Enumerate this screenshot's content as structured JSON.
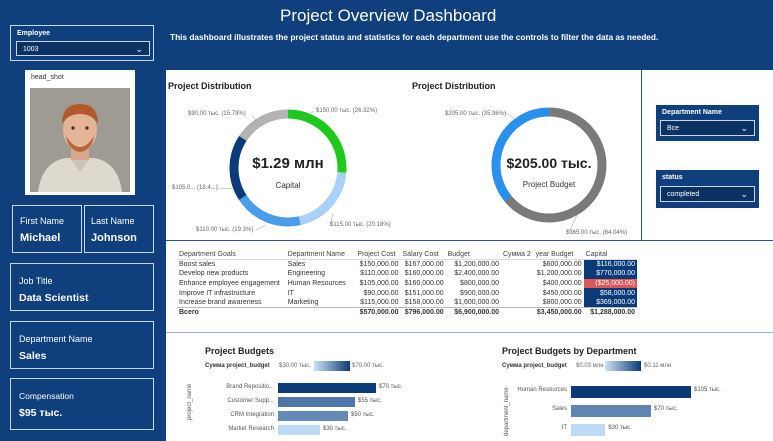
{
  "header": {
    "title": "Project Overview Dashboard",
    "subtitle": "This dashboard illustrates the project status and statistics for each department use the controls to filter the data as needed."
  },
  "employee_filter": {
    "label": "Employee",
    "value": "1003"
  },
  "photo": {
    "caption": "head_shot"
  },
  "profile": {
    "first_name_label": "First Name",
    "first_name": "Michael",
    "last_name_label": "Last Name",
    "last_name": "Johnson",
    "job_title_label": "Job Title",
    "job_title": "Data Scientist",
    "department_label": "Department Name",
    "department": "Sales",
    "compensation_label": "Compensation",
    "compensation": "$95 тыс."
  },
  "filters": {
    "department": {
      "label": "Department Name",
      "value": "Все"
    },
    "status": {
      "label": "status",
      "value": "completed"
    }
  },
  "donut1": {
    "title": "Project Distribution",
    "center_value": "$1.29 млн",
    "center_label": "Capital",
    "labels": {
      "top_right": "$150.00 тыс. (26.32%)",
      "right": "$115.00 тыс. (20.18%)",
      "bottom_left": "$110.00 тыс. (19.3%)",
      "left": "$105.0... (18.4...)",
      "top_left": "$90.00 тыс. (15.79%)"
    }
  },
  "donut2": {
    "title": "Project Distribution",
    "center_value": "$205.00 тыс.",
    "center_label": "Project Budget",
    "labels": {
      "top_left": "$205.00 тыс. (35.96%)",
      "bottom_right": "$365.00 тыс. (64.04%)"
    }
  },
  "table": {
    "headers": [
      "Department Goals",
      "Department Name",
      "Project Cost",
      "Salary Cost",
      "Budget",
      "Сумма 2",
      "year Budget",
      "Capital"
    ],
    "rows": [
      [
        "Boost sales",
        "Sales",
        "$150,000.00",
        "$167,000.00",
        "$1,200,000.00",
        "",
        "$600,000.00",
        "$116,000.00"
      ],
      [
        "Develop new products",
        "Engineering",
        "$110,000.00",
        "$160,000.00",
        "$2,400,000.00",
        "",
        "$1,200,000.00",
        "$770,000.00"
      ],
      [
        "Enhance employee engagement",
        "Human Resources",
        "$105,000.00",
        "$160,000.00",
        "$800,000.00",
        "",
        "$400,000.00",
        "($25,000.00)"
      ],
      [
        "Improve IT infrastructure",
        "IT",
        "$90,000.00",
        "$151,000.00",
        "$900,000.00",
        "",
        "$450,000.00",
        "$58,000.00"
      ],
      [
        "Increase brand awareness",
        "Marketing",
        "$115,000.00",
        "$158,000.00",
        "$1,600,000.00",
        "",
        "$800,000.00",
        "$369,000.00"
      ]
    ],
    "total": [
      "Всего",
      "",
      "$570,000.00",
      "$796,000.00",
      "$6,900,000.00",
      "",
      "$3,450,000.00",
      "$1,288,000.00"
    ]
  },
  "budgets1": {
    "title": "Project Budgets",
    "legend_label": "Сумма project_budget",
    "legend_min": "$30.00 тыс.",
    "legend_max": "$70.00 тыс.",
    "axis_label": "project_name",
    "bars": [
      {
        "name": "Brand Repositio...",
        "label": "$70 тыс.",
        "value": 70
      },
      {
        "name": "Customer Supp...",
        "label": "$55 тыс.",
        "value": 55
      },
      {
        "name": "CRM Integration",
        "label": "$50 тыс.",
        "value": 50
      },
      {
        "name": "Market Research",
        "label": "$30 тыс.",
        "value": 30
      }
    ]
  },
  "budgets2": {
    "title": "Project Budgets by Department",
    "legend_label": "Сумма project_budget",
    "legend_min": "$0.03 млн",
    "legend_max": "$0.11 млн",
    "axis_label": "department_name",
    "bars": [
      {
        "name": "Human Resources",
        "label": "$105 тыс.",
        "value": 105
      },
      {
        "name": "Sales",
        "label": "$70 тыс.",
        "value": 70
      },
      {
        "name": "IT",
        "label": "$30 тыс.",
        "value": 30
      }
    ]
  }
}
